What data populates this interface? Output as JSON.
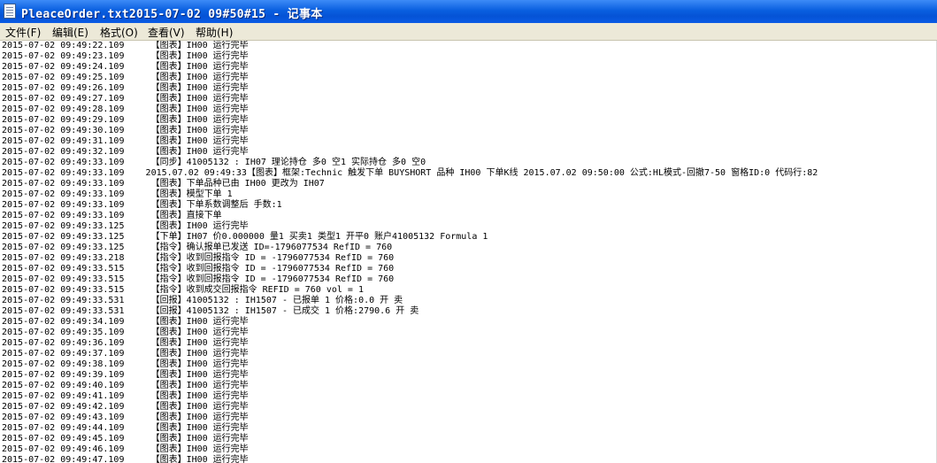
{
  "window": {
    "title": "PleaceOrder.txt2015-07-02 09#50#15 - 记事本",
    "icon": "notepad-icon"
  },
  "menu": [
    "文件(F)",
    "编辑(E)",
    "格式(O)",
    "查看(V)",
    "帮助(H)"
  ],
  "lines": [
    "2015-07-02 09:49:22.109     【图表】IH00 运行完毕",
    "2015-07-02 09:49:23.109     【图表】IH00 运行完毕",
    "2015-07-02 09:49:24.109     【图表】IH00 运行完毕",
    "2015-07-02 09:49:25.109     【图表】IH00 运行完毕",
    "2015-07-02 09:49:26.109     【图表】IH00 运行完毕",
    "2015-07-02 09:49:27.109     【图表】IH00 运行完毕",
    "2015-07-02 09:49:28.109     【图表】IH00 运行完毕",
    "2015-07-02 09:49:29.109     【图表】IH00 运行完毕",
    "2015-07-02 09:49:30.109     【图表】IH00 运行完毕",
    "2015-07-02 09:49:31.109     【图表】IH00 运行完毕",
    "2015-07-02 09:49:32.109     【图表】IH00 运行完毕",
    "2015-07-02 09:49:33.109     【同步】41005132 : IH07 理论持仓 多0 空1 实际持仓 多0 空0",
    "2015-07-02 09:49:33.109    2015.07.02 09:49:33【图表】框架:Technic 触发下单 BUYSHORT 品种 IH00 下单K线 2015.07.02 09:50:00 公式:HL模式-回撤7-50 窗格ID:0 代码行:82",
    "2015-07-02 09:49:33.109     【图表】下单品种已由 IH00 更改为 IH07",
    "2015-07-02 09:49:33.109     【图表】模型下单 1",
    "2015-07-02 09:49:33.109     【图表】下单系数调整后 手数:1",
    "2015-07-02 09:49:33.109     【图表】直接下单",
    "2015-07-02 09:49:33.125     【图表】IH00 运行完毕",
    "2015-07-02 09:49:33.125     【下单】IH07 价0.000000 量1 买卖1 类型1 开平0 账户41005132 Formula 1",
    "2015-07-02 09:49:33.125     【指令】确认报单已发送 ID=-1796077534 RefID = 760",
    "2015-07-02 09:49:33.218     【指令】收到回报指令 ID = -1796077534 RefID = 760",
    "2015-07-02 09:49:33.515     【指令】收到回报指令 ID = -1796077534 RefID = 760",
    "2015-07-02 09:49:33.515     【指令】收到回报指令 ID = -1796077534 RefID = 760",
    "2015-07-02 09:49:33.515     【指令】收到成交回报指令 REFID = 760 vol = 1",
    "2015-07-02 09:49:33.531     【回报】41005132 : IH1507 - 已报单 1 价格:0.0 开 卖",
    "2015-07-02 09:49:33.531     【回报】41005132 : IH1507 - 已成交 1 价格:2790.6 开 卖",
    "2015-07-02 09:49:34.109     【图表】IH00 运行完毕",
    "2015-07-02 09:49:35.109     【图表】IH00 运行完毕",
    "2015-07-02 09:49:36.109     【图表】IH00 运行完毕",
    "2015-07-02 09:49:37.109     【图表】IH00 运行完毕",
    "2015-07-02 09:49:38.109     【图表】IH00 运行完毕",
    "2015-07-02 09:49:39.109     【图表】IH00 运行完毕",
    "2015-07-02 09:49:40.109     【图表】IH00 运行完毕",
    "2015-07-02 09:49:41.109     【图表】IH00 运行完毕",
    "2015-07-02 09:49:42.109     【图表】IH00 运行完毕",
    "2015-07-02 09:49:43.109     【图表】IH00 运行完毕",
    "2015-07-02 09:49:44.109     【图表】IH00 运行完毕",
    "2015-07-02 09:49:45.109     【图表】IH00 运行完毕",
    "2015-07-02 09:49:46.109     【图表】IH00 运行完毕",
    "2015-07-02 09:49:47.109     【图表】IH00 运行完毕"
  ]
}
